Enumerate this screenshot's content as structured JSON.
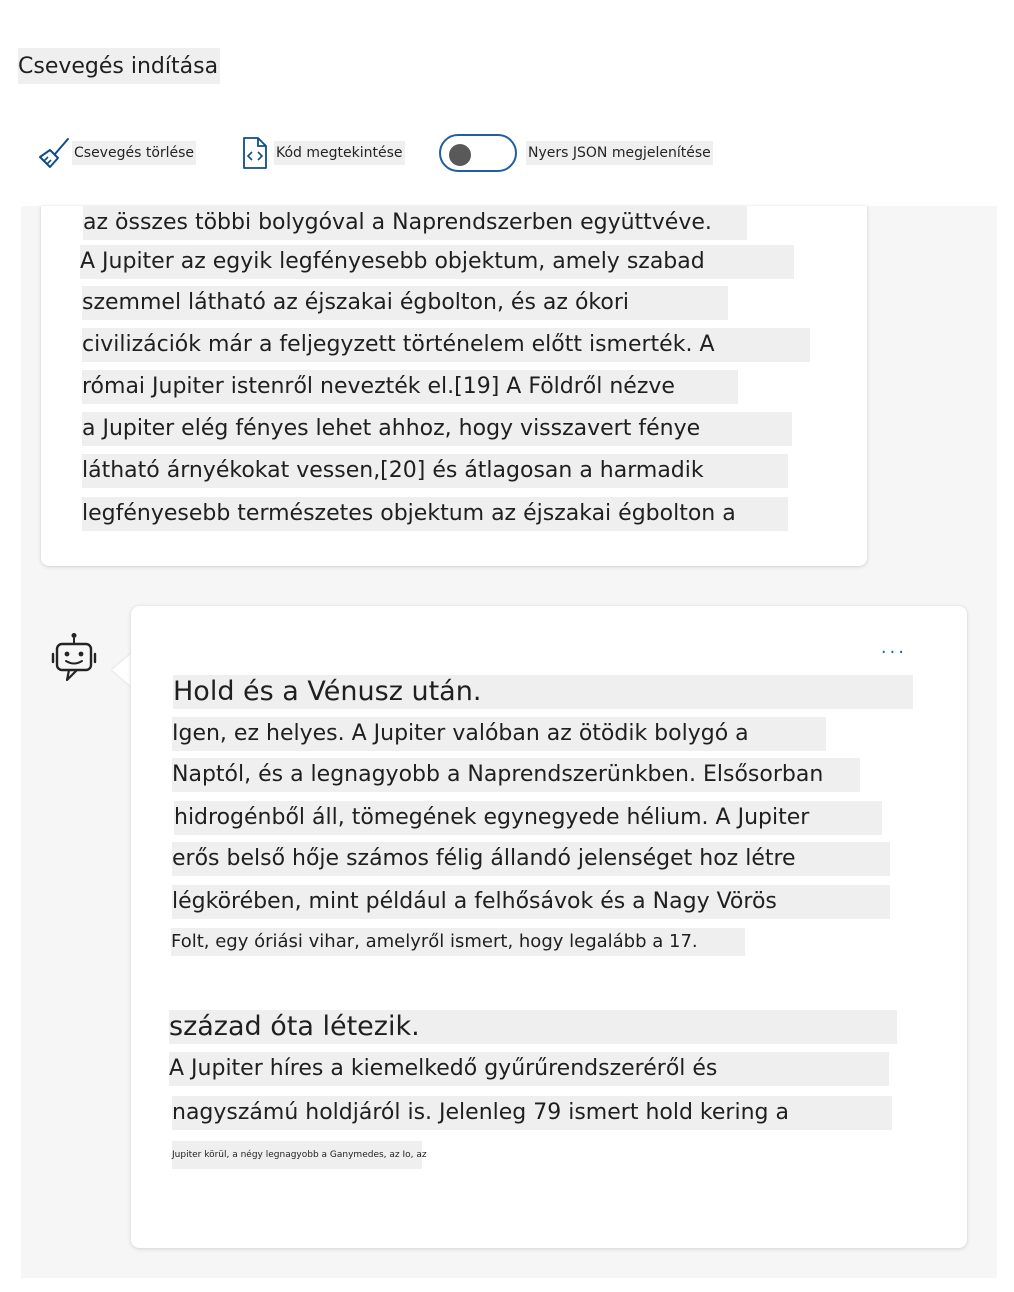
{
  "header": {
    "title": "Csevegés indítása"
  },
  "toolbar": {
    "clear_label": "Csevegés törlése",
    "view_code_label": "Kód megtekintése",
    "json_label": "Nyers JSON megjelenítése"
  },
  "user_message": {
    "lines": [
      "az összes többi bolygóval a Naprendszerben együttvéve.",
      "A Jupiter az egyik legfényesebb objektum, amely szabad",
      "szemmel látható az éjszakai égbolton, és az ókori",
      "civilizációk már a feljegyzett történelem előtt ismerték. A",
      "római Jupiter istenről nevezték el.[19] A Földről nézve",
      "a Jupiter elég fényes lehet ahhoz, hogy visszavert fénye",
      "látható árnyékokat vessen,[20] és átlagosan a harmadik",
      "legfényesebb természetes objektum az éjszakai égbolton a"
    ]
  },
  "bot_message": {
    "more_label": "...",
    "lines": [
      "Hold és a Vénusz után.",
      "Igen, ez helyes. A Jupiter valóban az ötödik bolygó a",
      "Naptól, és a legnagyobb a Naprendszerünkben. Elsősorban",
      "hidrogénből áll, tömegének egynegyede hélium. A Jupiter",
      "erős belső hője számos félig állandó jelenséget hoz létre",
      "légkörében, mint például a felhősávok és a Nagy Vörös",
      "Folt, egy óriási vihar, amelyről ismert, hogy legalább a 17.",
      "század óta létezik.",
      "A Jupiter híres a kiemelkedő gyűrűrendszeréről és",
      "nagyszámú holdjáról is. Jelenleg 79 ismert hold kering a",
      "Jupiter körül, a négy legnagyobb a Ganymedes, az Io, az"
    ]
  },
  "colors": {
    "accent": "#0f6cbd",
    "toggle_border": "#1f5fa0",
    "panel_bg": "#f6f6f6",
    "text_highlight": "#efefef"
  },
  "icons": {
    "clear": "broom-icon",
    "code": "code-file-icon",
    "avatar": "bot-icon",
    "more": "more-dots-icon"
  }
}
